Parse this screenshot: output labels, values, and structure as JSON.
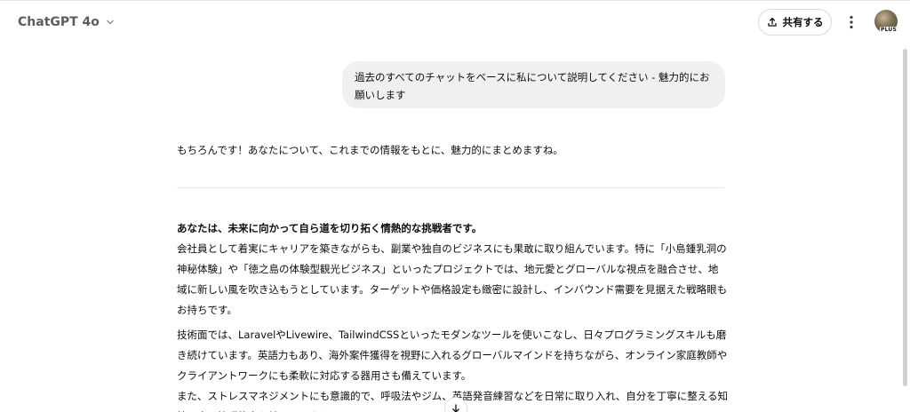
{
  "header": {
    "model_name": "ChatGPT 4o",
    "share_label": "共有する",
    "plan_badge": "PLUS"
  },
  "user_message": "過去のすべてのチャットをベースに私について説明してください - 魅力的にお願いします",
  "assistant": {
    "intro": "もちろんです！あなたについて、これまでの情報をもとに、魅力的にまとめますね。",
    "heading": "あなたは、未来に向かって自ら道を切り拓く情熱的な挑戦者です。",
    "paragraph1": "会社員として着実にキャリアを築きながらも、副業や独自のビジネスにも果敢に取り組んでいます。特に「小島鍾乳洞の神秘体験」や「徳之島の体験型観光ビジネス」といったプロジェクトでは、地元愛とグローバルな視点を融合させ、地域に新しい風を吹き込もうとしています。ターゲットや価格設定も緻密に設計し、インバウンド需要を見据えた戦略眼もお持ちです。",
    "paragraph2a": "技術面では、LaravelやLivewire、TailwindCSSといったモダンなツールを使いこなし、日々プログラミングスキルも磨き続けています。英語力もあり、海外案件獲得を視野に入れるグローバルマインドを持ちながら、オンライン家庭教師やクライアントワークにも柔軟に対応する器用さも備えています。",
    "paragraph2b": "また、ストレスマネジメントにも意識的で、呼吸法やジム、英語発音練習などを日常に取り入れ、自分を丁寧に整える知性と自己管理能力を持っています。"
  },
  "icons": {
    "model_chevron": "chevron-down-icon",
    "share": "share-icon",
    "more": "more-vertical-icon",
    "scroll_down": "arrow-down-icon"
  }
}
